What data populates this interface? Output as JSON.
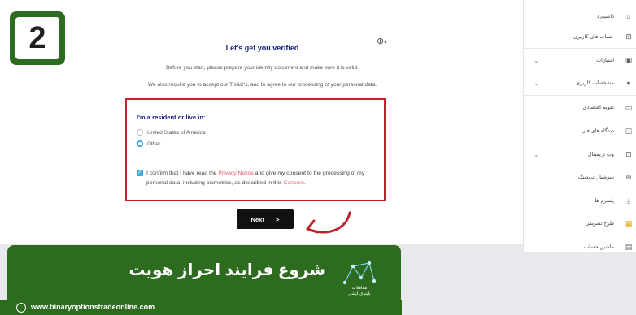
{
  "step": {
    "number": "2"
  },
  "card": {
    "title": "Let's get you verified",
    "intro1": "Before you start, please prepare your identity document and make sure it is valid.",
    "intro2": "We also require you to accept our T's&C's, and to agree to our processing of your personal data.",
    "residency": {
      "title": "I'm a resident or live in:",
      "options": [
        {
          "label": "United States of America",
          "selected": false
        },
        {
          "label": "Other",
          "selected": true
        }
      ]
    },
    "consent": {
      "prefix": "I confirm that I have read the ",
      "privacy_link": "Privacy Notice",
      "middle": " and give my consent to the processing of my personal data, including biometrics, as described in this ",
      "consent_link": "Consent",
      "suffix": ".",
      "checked": true
    },
    "next_label": "Next",
    "next_arrow": ">"
  },
  "banner": {
    "title": "شروع فرایند احراز هویت",
    "logo_line1": "معاملات",
    "logo_line2": "باینری آپشن",
    "website": "www.binaryoptionstradeonline.com"
  },
  "sidebar": {
    "items": [
      {
        "label": "داشبورد",
        "icon": "home-icon",
        "glyph": "⌂",
        "chevron": false
      },
      {
        "label": "حساب های کاربری",
        "icon": "grid-icon",
        "glyph": "⊞",
        "chevron": false
      },
      {
        "label": "امتیازات",
        "icon": "wallet-icon",
        "glyph": "▣",
        "chevron": true
      },
      {
        "label": "مشخصات کاربری",
        "icon": "user-icon",
        "glyph": "👤",
        "chevron": true
      },
      {
        "label": "تقویم اقتصادی",
        "icon": "calendar-icon",
        "glyph": "▭",
        "chevron": false
      },
      {
        "label": "دیدگاه های فنی",
        "icon": "analysis-icon",
        "glyph": "◫",
        "chevron": false
      },
      {
        "label": "وب تریمینال",
        "icon": "chart-icon",
        "glyph": "⊡",
        "chevron": true
      },
      {
        "label": "سوشیال تریدینگ",
        "icon": "globe-icon",
        "glyph": "⊕",
        "chevron": false
      },
      {
        "label": "پلتفرم ها",
        "icon": "download-icon",
        "glyph": "⤓",
        "chevron": false
      },
      {
        "label": "طرح تشویقی",
        "icon": "gift-icon",
        "glyph": "▦",
        "chevron": false
      },
      {
        "label": "ماشین حساب",
        "icon": "calculator-icon",
        "glyph": "▤",
        "chevron": false
      }
    ]
  },
  "colors": {
    "brand_green": "#2d6b1f",
    "highlight_red": "#c0222a",
    "title_navy": "#1a237e",
    "accent_blue": "#39a9e0",
    "link_pink": "#e25a6c"
  }
}
